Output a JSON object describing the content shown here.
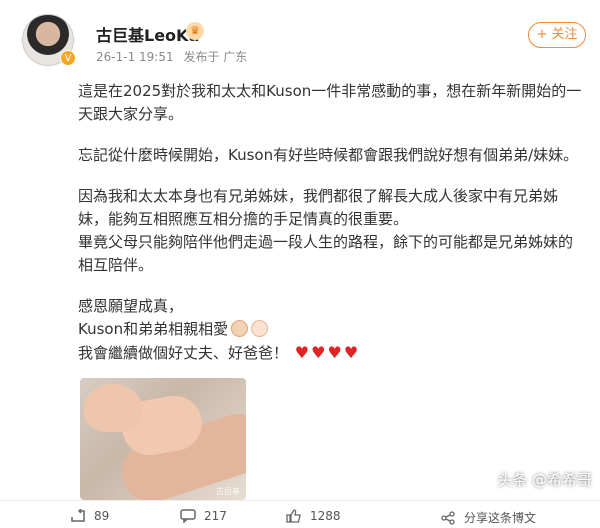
{
  "user": {
    "name": "古巨基LeoKu",
    "date": "26-1-1 19:51",
    "location": "发布于 广东",
    "follow_label": "+ 关注"
  },
  "post": {
    "p1": "這是在2025對於我和太太和Kuson一件非常感動的事，想在新年新開始的一天跟大家分享。",
    "p2": "忘記從什麼時候開始，Kuson有好些時候都會跟我們說好想有個弟弟/妹妹。",
    "p3a": "因為我和太太本身也有兄弟姊妹，我們都很了解長大成人後家中有兄弟姊妹，能夠互相照應互相分擔的手足情真的很重要。",
    "p3b": "畢竟父母只能夠陪伴他們走過一段人生的路程，餘下的可能都是兄弟姊妹的相互陪伴。",
    "p4a": "感恩願望成真，",
    "p4b": "Kuson和弟弟相親相愛",
    "p4c": "我會繼續做個好丈夫、好爸爸！"
  },
  "photo": {
    "watermark": "古巨基"
  },
  "actions": {
    "repost": "89",
    "comments": "217",
    "likes": "1288",
    "source": "头条 @希希哥",
    "share_text": "分享这条博文"
  },
  "icons": {
    "heart": "♥",
    "crown": "♛",
    "vip": "V"
  }
}
